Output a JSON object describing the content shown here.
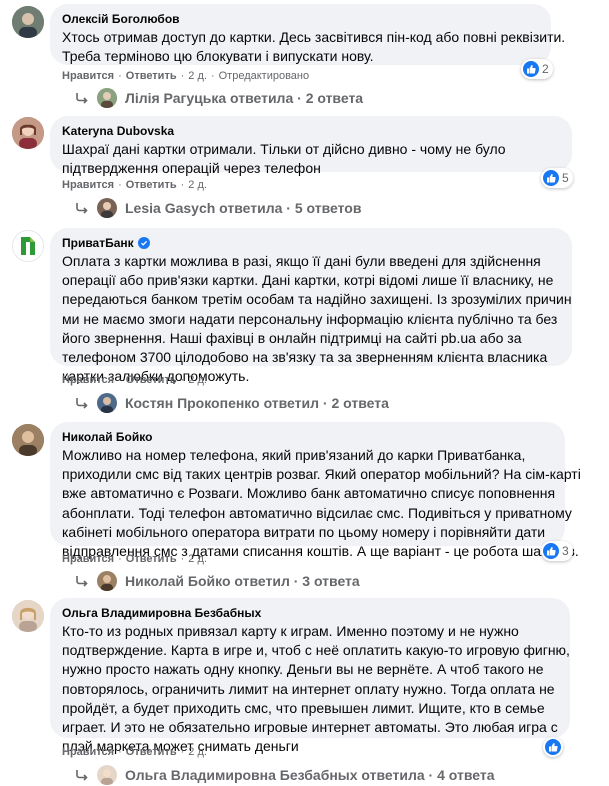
{
  "ui": {
    "like_label": "Нравится",
    "reply_label": "Ответить",
    "separator": "·",
    "edited_label": "Отредактировано"
  },
  "comments": [
    {
      "author": "Олексій Боголюбов",
      "lines": [
        "Хтось отримав доступ до картки. Десь засвітився пін-код або повні реквізити.",
        "Треба терміново цю блокувати і випускати нову."
      ],
      "time": "2 д.",
      "edited": true,
      "reactions": "2",
      "replies_author": "Лілія Рагуцька ответила",
      "replies_count": "2 ответа",
      "avatar_color": "#7d8a7a",
      "reply_avatar_color": "#8aa27f",
      "like_icon": "like-icon"
    },
    {
      "author": "Kateryna Dubovska",
      "lines": [
        "Шахраї дані картки отримали. Тільки от дійсно дивно - чому не було",
        "підтвердження операцій через телефон"
      ],
      "time": "2 д.",
      "edited": false,
      "reactions": "5",
      "replies_author": "Lesia Gasych ответила",
      "replies_count": "5 ответов",
      "avatar_color": "#a7776a",
      "reply_avatar_color": "#7b6256",
      "like_icon": "like-icon"
    },
    {
      "author": "ПриватБанк",
      "verified": true,
      "lines": [
        "Оплата з картки можлива в разі, якщо її дані були введені для здійснення",
        "операції або прив'язки картки. Дані картки, котрі відомі лише її власнику, не",
        "передаються банком третім особам та надійно захищені. Із зрозумілих причин",
        "ми не маємо змоги надати персональну інформацію клієнта публічно та без",
        "його звернення. Наші фахівці в онлайн підтримці на сайті pb.ua або за",
        "телефоном 3700 цілодобово на зв'язку та за зверненням клієнта власника",
        "картки залюбки допоможуть."
      ],
      "time": "2 д.",
      "edited": false,
      "replies_author": "Костян Прокопенко ответил",
      "replies_count": "2 ответа",
      "avatar_color": "#ffffff",
      "brand_color": "#2d9a37",
      "reply_avatar_color": "#4d6a8a"
    },
    {
      "author": "Николай Бойко",
      "lines": [
        "Можливо на номер телефона, який прив'язаний до карки Приватбанка,",
        "приходили смс від таких центрів розваг. Який оператор мобільний? На сім-карті",
        "вже автоматично є Розваги. Можливо банк автоматично списує поповнення",
        "абонплати. Тоді телефон автоматично відсилає смс. Подивіться у приватному",
        "кабінеті мобільного оператора витрати по цьому номеру і порівняйти дати",
        "відправлення смс з датами списання коштів. А ще варіант - це робота шахраїв."
      ],
      "time": "2 д.",
      "edited": false,
      "reactions": "3",
      "replies_author": "Николай Бойко ответил",
      "replies_count": "3 ответа",
      "avatar_color": "#8a6e52",
      "reply_avatar_color": "#8a6e52",
      "like_icon": "like-icon"
    },
    {
      "author": "Ольга Владимировна Безбабных",
      "lines": [
        "Кто-то из родных привязал карту к играм. Именно поэтому и не нужно",
        "подтверждение. Карта в игре и, чтоб с неё оплатить какую-то игровую фигню,",
        "нужно просто нажать одну кнопку. Деньги вы не вернёте. А чтоб такого не",
        "повторялось, ограничить лимит на интернет оплату нужно. Тогда оплата не",
        "пройдёт, а будет приходить смс, что превышен лимит. Ищите, кто в семье",
        "играет. И это не обязательно игровые интернет автоматы. Это любая игра с",
        "плэй маркета может снимать деньги"
      ],
      "time": "2 д.",
      "edited": false,
      "reactions": "",
      "replies_author": "Ольга Владимировна Безбабных ответила",
      "replies_count": "4 ответа",
      "avatar_color": "#d9c3b3",
      "reply_avatar_color": "#d9c3b3",
      "like_icon": "like-icon"
    }
  ]
}
